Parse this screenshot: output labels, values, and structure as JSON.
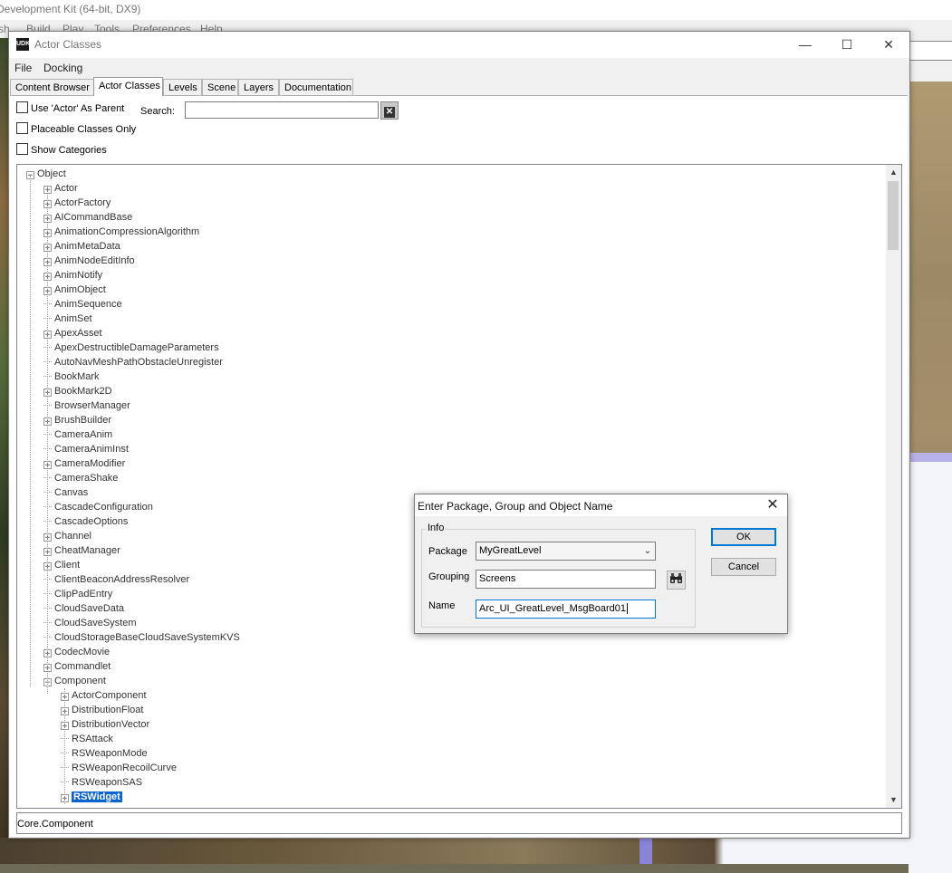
{
  "background": {
    "title": "Development Kit (64-bit, DX9)",
    "menu": [
      "sh",
      "Build",
      "Play",
      "Tools",
      "Preferences",
      "Help"
    ]
  },
  "window": {
    "icon_text": "UDK",
    "title": "Actor Classes",
    "controls": {
      "minimize": "—",
      "maximize": "☐",
      "close": "✕"
    },
    "menu": [
      "File",
      "Docking"
    ],
    "tabs": [
      "Content Browser",
      "Actor Classes",
      "Levels",
      "Scene",
      "Layers",
      "Documentation"
    ],
    "active_tab": "Actor Classes"
  },
  "filters": {
    "use_actor_parent": "Use 'Actor' As Parent",
    "placeable_only": "Placeable Classes Only",
    "show_categories": "Show Categories",
    "search_label": "Search:",
    "search_value": "",
    "clear_icon": "close-icon"
  },
  "tree": {
    "root": "Object",
    "items": [
      {
        "label": "Actor",
        "expandable": true
      },
      {
        "label": "ActorFactory",
        "expandable": true
      },
      {
        "label": "AICommandBase",
        "expandable": true
      },
      {
        "label": "AnimationCompressionAlgorithm",
        "expandable": true
      },
      {
        "label": "AnimMetaData",
        "expandable": true
      },
      {
        "label": "AnimNodeEditInfo",
        "expandable": true
      },
      {
        "label": "AnimNotify",
        "expandable": true
      },
      {
        "label": "AnimObject",
        "expandable": true
      },
      {
        "label": "AnimSequence",
        "expandable": false
      },
      {
        "label": "AnimSet",
        "expandable": false
      },
      {
        "label": "ApexAsset",
        "expandable": true
      },
      {
        "label": "ApexDestructibleDamageParameters",
        "expandable": false
      },
      {
        "label": "AutoNavMeshPathObstacleUnregister",
        "expandable": false
      },
      {
        "label": "BookMark",
        "expandable": false
      },
      {
        "label": "BookMark2D",
        "expandable": true
      },
      {
        "label": "BrowserManager",
        "expandable": false
      },
      {
        "label": "BrushBuilder",
        "expandable": true
      },
      {
        "label": "CameraAnim",
        "expandable": false
      },
      {
        "label": "CameraAnimInst",
        "expandable": false
      },
      {
        "label": "CameraModifier",
        "expandable": true
      },
      {
        "label": "CameraShake",
        "expandable": false
      },
      {
        "label": "Canvas",
        "expandable": false
      },
      {
        "label": "CascadeConfiguration",
        "expandable": false
      },
      {
        "label": "CascadeOptions",
        "expandable": false
      },
      {
        "label": "Channel",
        "expandable": true
      },
      {
        "label": "CheatManager",
        "expandable": true
      },
      {
        "label": "Client",
        "expandable": true
      },
      {
        "label": "ClientBeaconAddressResolver",
        "expandable": false
      },
      {
        "label": "ClipPadEntry",
        "expandable": false
      },
      {
        "label": "CloudSaveData",
        "expandable": false
      },
      {
        "label": "CloudSaveSystem",
        "expandable": false
      },
      {
        "label": "CloudStorageBaseCloudSaveSystemKVS",
        "expandable": false
      },
      {
        "label": "CodecMovie",
        "expandable": true
      },
      {
        "label": "Commandlet",
        "expandable": true
      },
      {
        "label": "Component",
        "expandable": true,
        "expanded": true
      }
    ],
    "component_children": [
      {
        "label": "ActorComponent",
        "expandable": true
      },
      {
        "label": "DistributionFloat",
        "expandable": true
      },
      {
        "label": "DistributionVector",
        "expandable": true
      },
      {
        "label": "RSAttack",
        "expandable": false
      },
      {
        "label": "RSWeaponMode",
        "expandable": false
      },
      {
        "label": "RSWeaponRecoilCurve",
        "expandable": false
      },
      {
        "label": "RSWeaponSAS",
        "expandable": false
      },
      {
        "label": "RSWidget",
        "expandable": true,
        "selected": true
      }
    ],
    "scroll_up_icon": "▲",
    "scroll_down_icon": "▼"
  },
  "status": "Core.Component",
  "dialog": {
    "title": "Enter Package, Group and Object Name",
    "close": "✕",
    "group_label": "Info",
    "package_label": "Package",
    "package_value": "MyGreatLevel",
    "grouping_label": "Grouping",
    "grouping_value": "Screens",
    "name_label": "Name",
    "name_value": "Arc_UI_GreatLevel_MsgBoard01",
    "browse_icon": "binoculars-icon",
    "ok": "OK",
    "cancel": "Cancel"
  }
}
